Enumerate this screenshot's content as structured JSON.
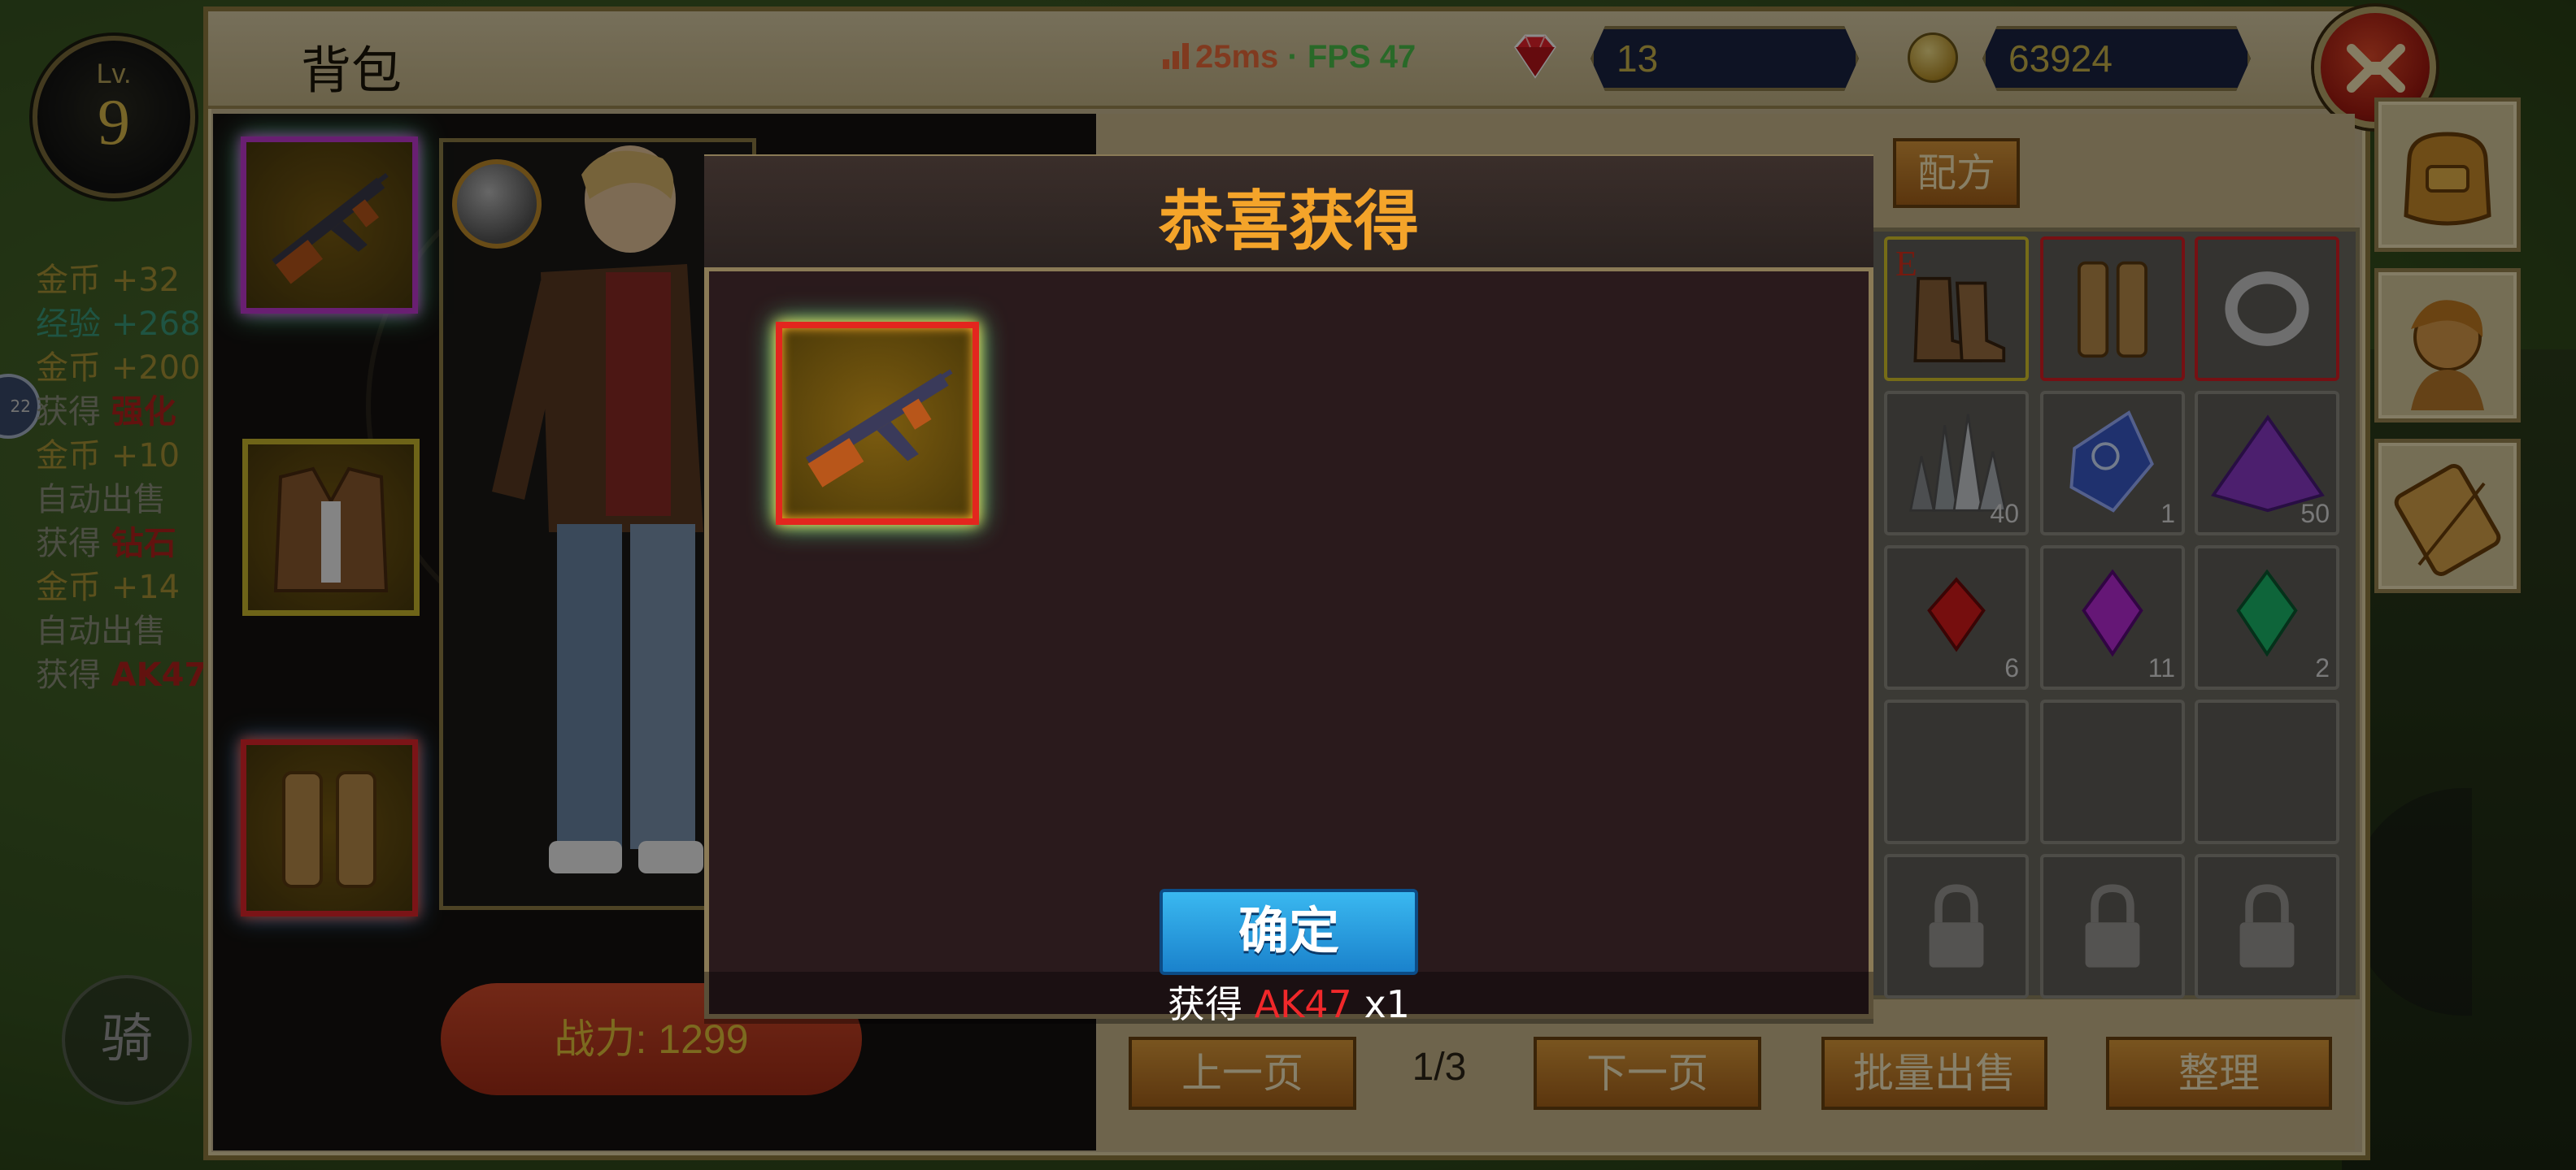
{
  "hud": {
    "level_prefix": "Lv.",
    "level": "9",
    "ride_label": "骑",
    "side_badge": "22"
  },
  "chat_log": [
    {
      "prefix": "金币",
      "suffix": " +32",
      "color": "gold"
    },
    {
      "prefix": "经验",
      "suffix": " +268",
      "color": "exp"
    },
    {
      "prefix": "金币",
      "suffix": " +200",
      "color": "gold"
    },
    {
      "prefix": "获得 ",
      "suffix": "强化",
      "color": "gray-red"
    },
    {
      "prefix": "金币",
      "suffix": " +10",
      "color": "gold"
    },
    {
      "prefix": "自动出售",
      "suffix": " ",
      "color": "gray"
    },
    {
      "prefix": "获得 ",
      "suffix": "钻石",
      "color": "gray-red"
    },
    {
      "prefix": "金币",
      "suffix": " +14",
      "color": "gold"
    },
    {
      "prefix": "自动出售",
      "suffix": " ",
      "color": "gray"
    },
    {
      "prefix": "获得 ",
      "suffix": "AK47",
      "color": "gray-red"
    }
  ],
  "window": {
    "title": "背包",
    "ping": "25ms",
    "separator": " · ",
    "fps": "FPS 47",
    "gems": "13",
    "coins": "63924"
  },
  "equipment": {
    "power_label": "战力: 1299"
  },
  "inventory": {
    "recipe_tab": "配方",
    "e_marker": "E",
    "counts": {
      "crystal": "40",
      "blue_gem": "1",
      "purple_gem": "50",
      "red_gem": "6",
      "violet_gem": "11",
      "green_gem": "2"
    },
    "prev_page": "上一页",
    "page": "1/3",
    "next_page": "下一页",
    "bulk_sell": "批量出售",
    "sort": "整理"
  },
  "dialog": {
    "title": "恭喜获得",
    "confirm": "确定",
    "summary_prefix": "获得 ",
    "item_name": "AK47",
    "summary_suffix": " x1"
  },
  "colors": {
    "accent_orange": "#f4a42a",
    "confirm_blue": "#1a82cc",
    "rarity_red": "#e3261e",
    "rarity_purple": "#c03ad0",
    "rarity_yellow": "#c8b62c"
  }
}
